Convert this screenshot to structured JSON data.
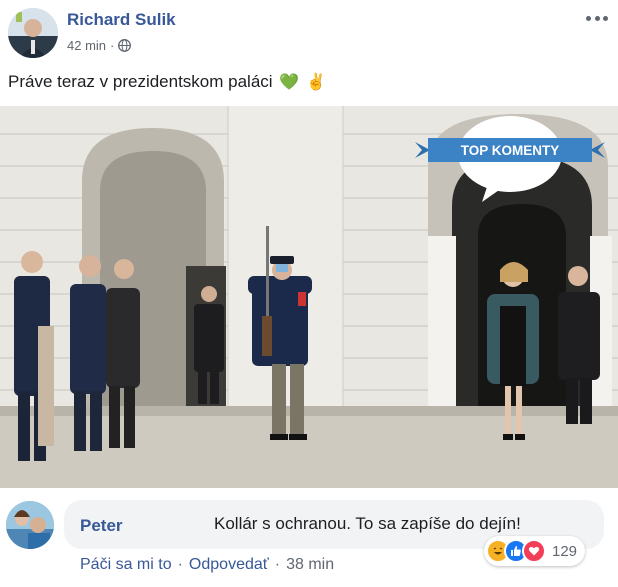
{
  "post": {
    "author": "Richard Sulik",
    "time": "42 min",
    "separator": "·",
    "privacy_icon": "globe-icon",
    "more_icon": "more-options-icon",
    "text": "Práve teraz v prezidentskom paláci",
    "emojis": [
      "💚",
      "✌️"
    ]
  },
  "photo": {
    "badge": "TOP KOMENTY",
    "description_icon": "palace-ceremony-photo"
  },
  "comment": {
    "author": "Peter",
    "text": "Kollár s ochranou. To sa zapíše do dejín!",
    "like_label": "Páči sa mi to",
    "reply_label": "Odpovedať",
    "separator": "·",
    "time": "38 min",
    "reaction_count": "129",
    "reactions": [
      "haha",
      "like",
      "love"
    ]
  },
  "colors": {
    "link": "#385898",
    "secondary": "#606770",
    "bubble": "#f2f3f5",
    "badge_blue": "#3b83c4"
  }
}
